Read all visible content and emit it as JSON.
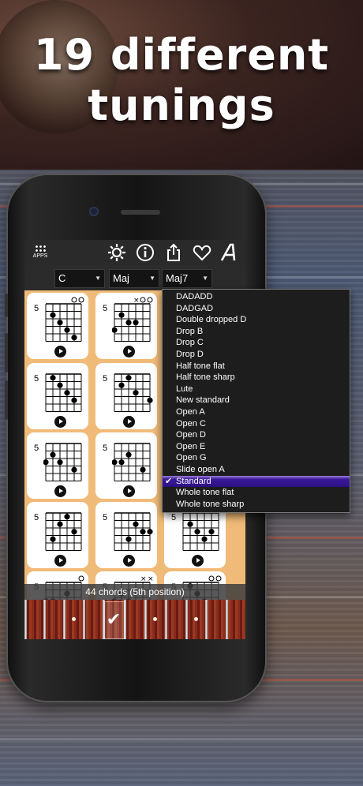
{
  "headline": {
    "line1": "19 different",
    "line2": "tunings"
  },
  "toolbar": {
    "apps_label": "APPS",
    "icons": [
      "apps-icon",
      "gear-icon",
      "info-icon",
      "share-icon",
      "heart-icon",
      "font-icon"
    ]
  },
  "pickers": {
    "root": "C",
    "quality": "Maj",
    "extension": "Maj7"
  },
  "chord_cards": {
    "fret_label": "5"
  },
  "tunings": {
    "items": [
      "DADADD",
      "DADGAD",
      "Double dropped D",
      "Drop B",
      "Drop C",
      "Drop D",
      "Half tone flat",
      "Half tone sharp",
      "Lute",
      "New standard",
      "Open A",
      "Open C",
      "Open D",
      "Open E",
      "Open G",
      "Slide open A",
      "Standard",
      "Whole tone flat",
      "Whole tone sharp"
    ],
    "selected": "Standard",
    "selected_index": 16
  },
  "status": {
    "text": "44 chords (5th position)"
  },
  "colors": {
    "grid_bg": "#f0bb78",
    "selection": "#2c0f84",
    "fretboard": "#8a2c1c"
  }
}
